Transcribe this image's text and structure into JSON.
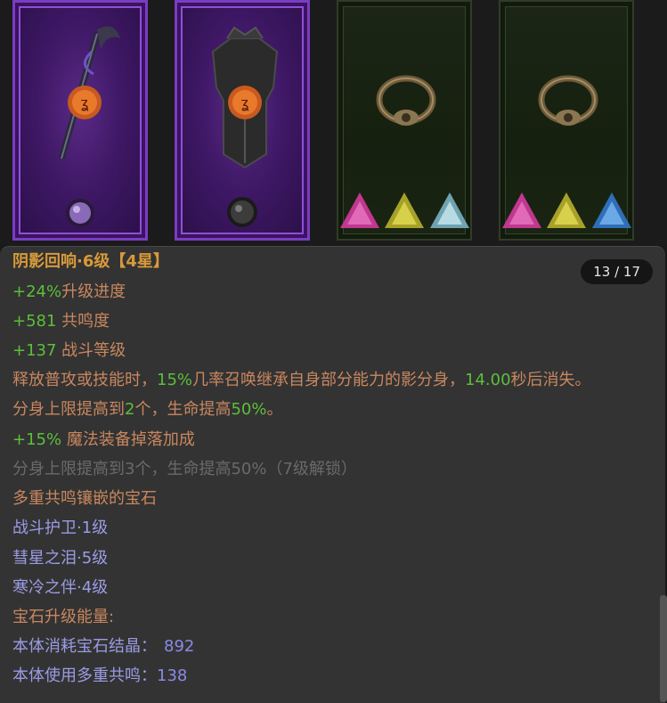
{
  "equipment": {
    "slots": [
      {
        "name": "weapon-slot",
        "item_icon": "staff-icon",
        "socket_icon": "purple-orb-socket-icon"
      },
      {
        "name": "armor-slot",
        "item_icon": "chestplate-icon",
        "socket_icon": "dark-orb-socket-icon"
      },
      {
        "name": "ring-slot-1",
        "item_icon": "ring-icon",
        "gems": [
          "pink-gem-icon",
          "yellow-gem-icon",
          "pale-blue-gem-icon"
        ]
      },
      {
        "name": "ring-slot-2",
        "item_icon": "ring-icon",
        "gems": [
          "pink-gem-icon",
          "yellow-gem-icon",
          "blue-gem-icon"
        ]
      }
    ],
    "colors": {
      "purple_frame": "#7b3cc2",
      "green_frame": "#2f3d25"
    }
  },
  "tooltip": {
    "title": "阴影回响·6级【4星】",
    "pager": "13 / 17",
    "stats": {
      "upgrade_value": "+24%",
      "upgrade_label": "升级进度",
      "resonance_value": "+581",
      "resonance_label": " 共鸣度",
      "combat_value": "+137",
      "combat_label": " 战斗等级"
    },
    "effect": {
      "p1": "释放普攻或技能时，",
      "v1": "15%",
      "p2": "几率召唤继承自身部分能力的影分身，",
      "v2": "14.00",
      "p3": "秒后消失。"
    },
    "clone": {
      "p1": "分身上限提高到",
      "v1": "2",
      "p2": "个，生命提高",
      "v2": "50%",
      "p3": "。"
    },
    "magic_value": "+15%",
    "magic_label": " 魔法装备掉落加成",
    "locked_text": "分身上限提高到3个，生命提高50%（7级解锁）",
    "gems_header": "多重共鸣镶嵌的宝石",
    "gems": [
      "战斗护卫·1级",
      "彗星之泪·5级",
      "寒冷之伴·4级"
    ],
    "energy_header": "宝石升级能量:",
    "crystal_label": "本体消耗宝石结晶：",
    "crystal_value": "892",
    "multi_label": "本体使用多重共鸣：",
    "multi_value": "138"
  }
}
